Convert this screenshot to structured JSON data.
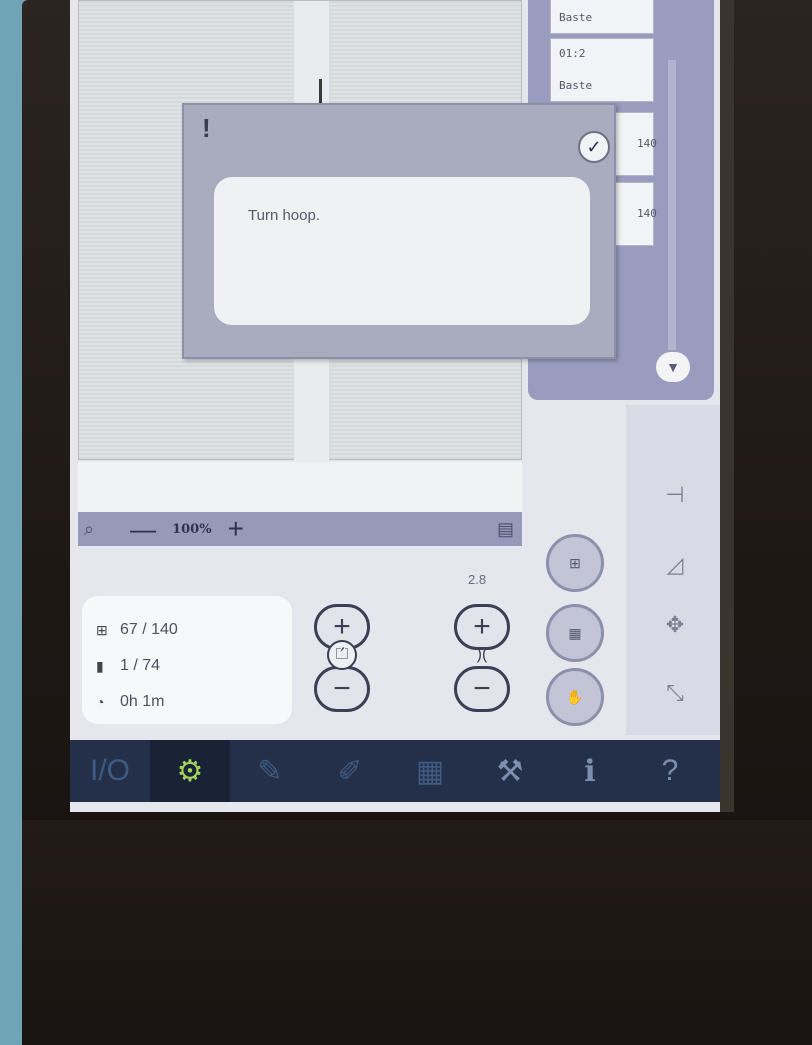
{
  "zoom": {
    "level": "100%"
  },
  "side_panel": {
    "blocks": [
      {
        "line1": "",
        "line2": "Baste"
      },
      {
        "line1": "01:2",
        "line2": "Baste"
      },
      {
        "line1": "",
        "line2": "140"
      },
      {
        "line1": "",
        "line2": "140"
      }
    ]
  },
  "info": {
    "stitch_count": "67 / 140",
    "color_block": "1 / 74",
    "time": "0h 1m"
  },
  "controls": {
    "tension_value": "2.8"
  },
  "dialog": {
    "message": "Turn hoop."
  },
  "colors": {
    "toolbar_bg": "#24304a",
    "active_icon": "#9fd35a",
    "panel_purple": "#9a9cbf",
    "dialog_bg": "#a9abbe"
  }
}
